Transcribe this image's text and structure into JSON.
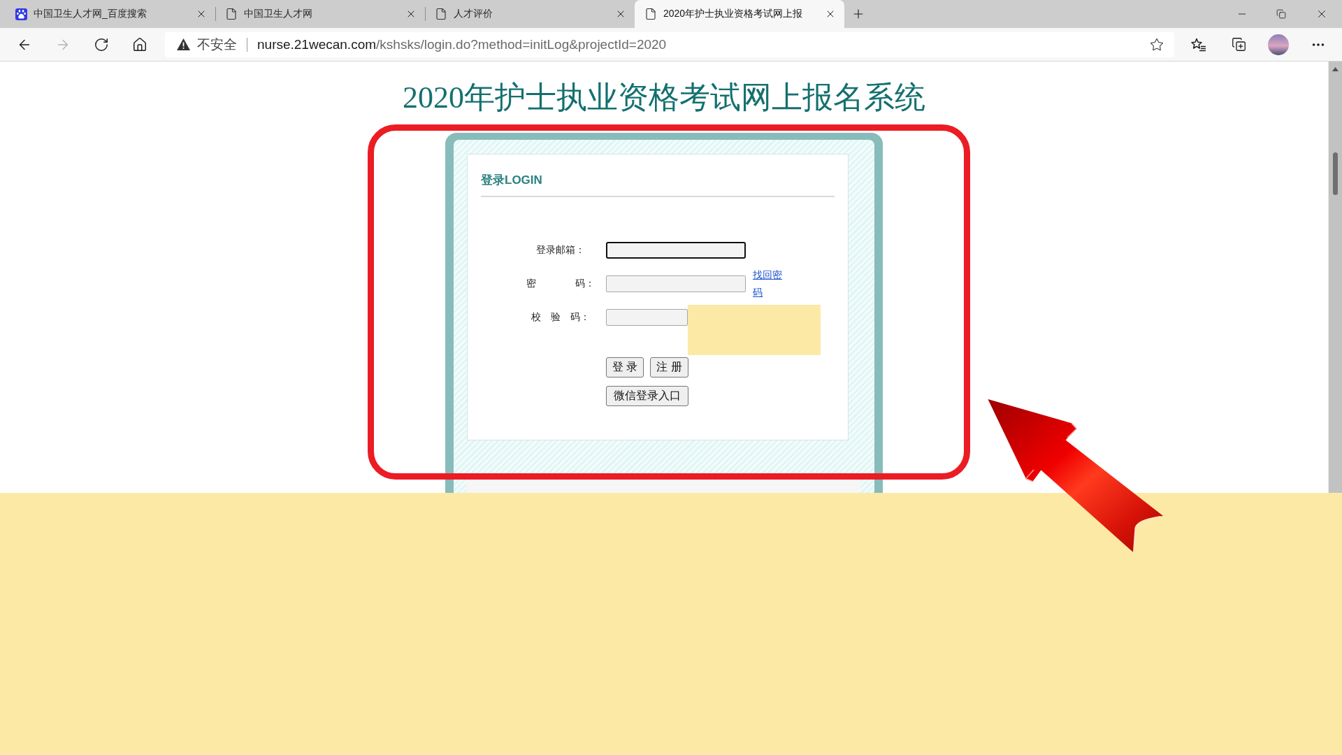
{
  "browser": {
    "tabs": [
      {
        "title": "中国卫生人才网_百度搜索",
        "kind": "search",
        "selected": false
      },
      {
        "title": "中国卫生人才网",
        "kind": "page",
        "selected": false
      },
      {
        "title": "人才评价",
        "kind": "page",
        "selected": false
      },
      {
        "title": "2020年护士执业资格考试网上报",
        "kind": "page",
        "selected": true
      }
    ],
    "nav_buttons": [
      {
        "kind": "back",
        "disabled": false
      },
      {
        "kind": "forward",
        "disabled": true
      },
      {
        "kind": "refresh",
        "disabled": false
      },
      {
        "kind": "home",
        "disabled": false
      }
    ],
    "address_bar": {
      "security": "不安全",
      "url": "nurse.21wecan.com/kshsks/login.do?method=initLog&projectId=2020"
    }
  },
  "page": {
    "title": "2020年护士执业资格考试网上报名系统",
    "login_panel": {
      "heading": "登录LOGIN",
      "fields": [
        {
          "label": "登录邮箱：",
          "kind": "text",
          "focused": true
        },
        {
          "label": "密　　　　码：",
          "kind": "password",
          "focused": false,
          "link": "找回密码"
        },
        {
          "label": "校　验　码：",
          "kind": "captcha",
          "focused": false
        }
      ],
      "buttons": [
        {
          "label": "登 录"
        },
        {
          "label": "注 册"
        }
      ],
      "wechat_button": "微信登录入口"
    }
  }
}
